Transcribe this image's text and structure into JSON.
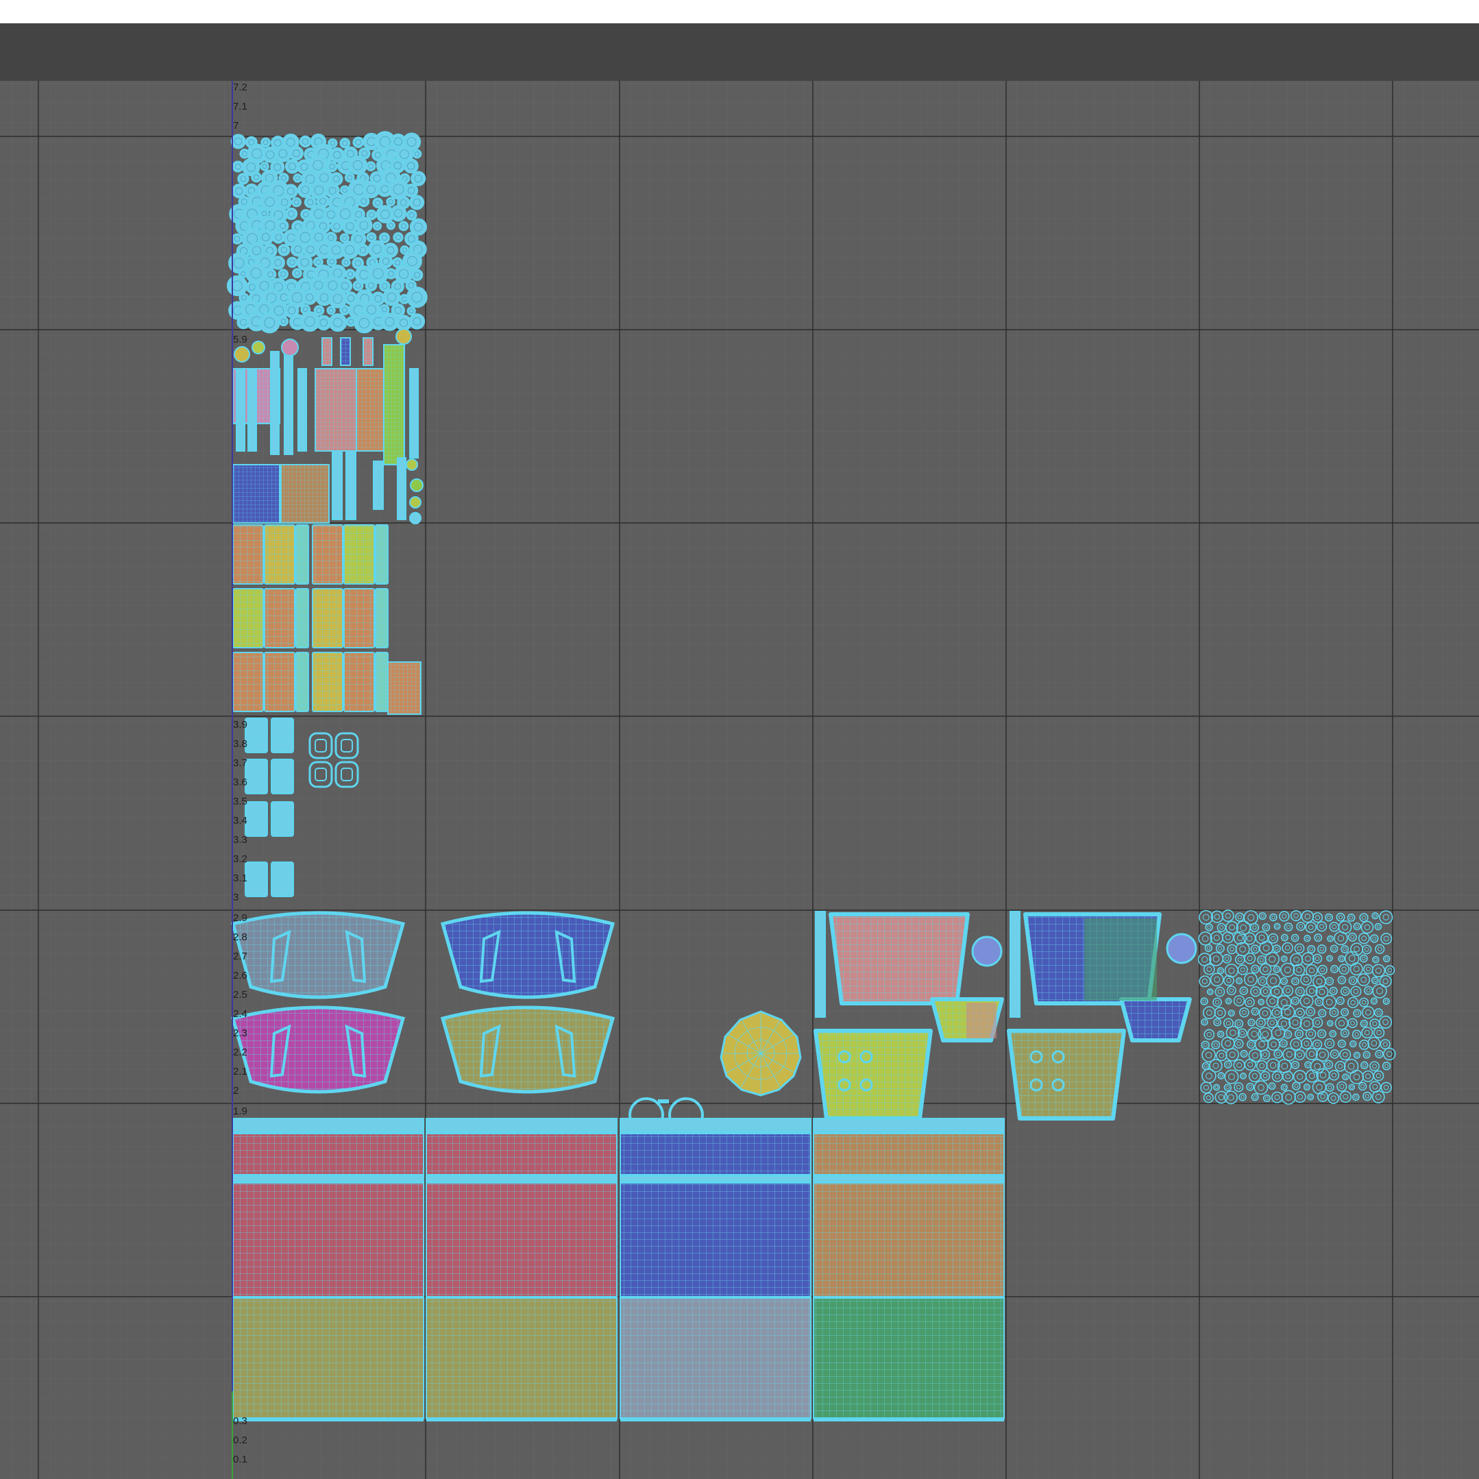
{
  "toolbar": {},
  "uv_grid": {
    "colors": {
      "background": "#5e5e5e",
      "minor_grid": "#676767",
      "major_grid": "#2d2d2d",
      "uv_wire": "#5fd6f0",
      "v_axis": "#3a3aa0",
      "origin_axis": "#3aa33a"
    },
    "v_tick_labels": [
      "7.2",
      "7.1",
      "7",
      "5.9",
      "3.9",
      "3.8",
      "3.7",
      "3.6",
      "3.5",
      "3.4",
      "3.3",
      "3.2",
      "3.1",
      "3",
      "2.9",
      "2.8",
      "2.7",
      "2.6",
      "2.5",
      "2.4",
      "2.3",
      "2.2",
      "2.1",
      "2",
      "1.9",
      "0.3",
      "0.2",
      "0.1"
    ],
    "fills": {
      "orange": "#c8895a",
      "yellow": "#c8b84a",
      "lime": "#b2c84a",
      "pink": "#c88ab0",
      "magenta": "#b44aa8",
      "blue": "#4a5ab8",
      "red": "#b45a6a",
      "olive": "#9c9c5a",
      "green": "#4a9c6a",
      "gray": "#8a96a8",
      "tan": "#b4885a",
      "lime_green": "#8ec84a",
      "salmon": "#c88a8a"
    }
  }
}
